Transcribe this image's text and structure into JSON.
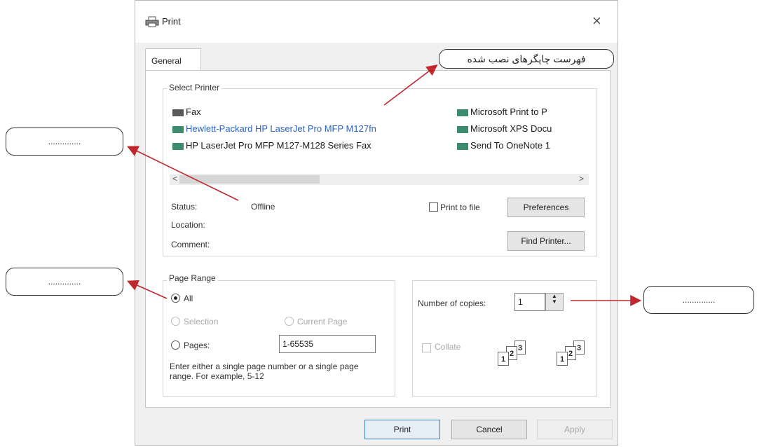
{
  "dialog": {
    "title": "Print",
    "close_glyph": "×",
    "tab_general": "General",
    "select_printer": {
      "group_label": "Select Printer",
      "printers_left": [
        {
          "name": "Fax",
          "icon": "fax-icon",
          "selected": false
        },
        {
          "name": "Hewlett-Packard HP LaserJet Pro MFP M127fn",
          "icon": "printer-icon",
          "selected": true
        },
        {
          "name": "HP LaserJet Pro MFP M127-M128 Series Fax",
          "icon": "printer-icon",
          "selected": false
        }
      ],
      "printers_right": [
        {
          "name": "Microsoft Print to P",
          "icon": "printer-icon"
        },
        {
          "name": "Microsoft XPS Docu",
          "icon": "printer-icon"
        },
        {
          "name": "Send To OneNote 1",
          "icon": "printer-icon"
        }
      ],
      "scroll_left": "<",
      "scroll_right": ">",
      "status_label": "Status:",
      "status_value": "Offline",
      "location_label": "Location:",
      "comment_label": "Comment:",
      "print_to_file": "Print to file",
      "preferences": "Preferences",
      "find_printer": "Find Printer..."
    },
    "page_range": {
      "group_label": "Page Range",
      "all": "All",
      "selection": "Selection",
      "current_page": "Current Page",
      "pages": "Pages:",
      "pages_value": "1-65535",
      "hint": "Enter either a single page number or a single page range.  For example, 5-12"
    },
    "copies": {
      "label": "Number of copies:",
      "value": "1",
      "collate": "Collate",
      "collate_pages": [
        "1",
        "2",
        "3"
      ]
    },
    "buttons": {
      "print": "Print",
      "cancel": "Cancel",
      "apply": "Apply"
    }
  },
  "annotations": {
    "top_callout": "فهرست چاپگرهای نصب شده",
    "left_callout_1": "..............",
    "left_callout_2": "..............",
    "right_callout": "..............",
    "arrow_color": "#c0282d"
  }
}
